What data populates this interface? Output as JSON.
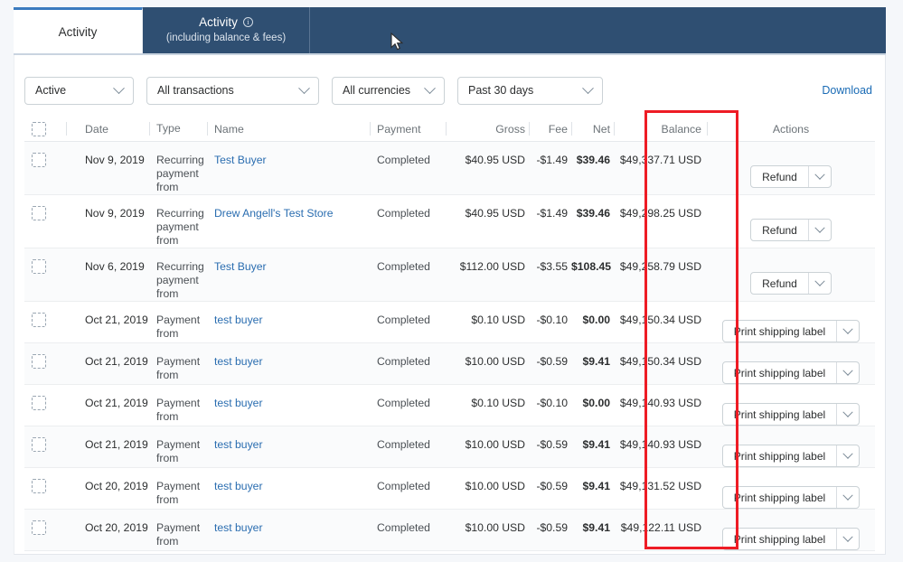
{
  "tabs": [
    {
      "label": "Activity",
      "sublabel": "",
      "info_icon": "",
      "active": true
    },
    {
      "label": "Activity",
      "sublabel": "(including balance & fees)",
      "info_icon": "i",
      "active": false
    },
    {
      "label": "",
      "sublabel": "",
      "info_icon": "",
      "active": false
    }
  ],
  "filters": {
    "status": "Active",
    "transactions": "All transactions",
    "currencies": "All currencies",
    "date_range": "Past 30 days",
    "download_label": "Download"
  },
  "table": {
    "headers": {
      "checkbox": "",
      "date": "Date",
      "type": "Type",
      "name": "Name",
      "payment": "Payment",
      "gross": "Gross",
      "fee": "Fee",
      "net": "Net",
      "balance": "Balance",
      "actions": "Actions"
    },
    "rows": [
      {
        "date": "Nov 9, 2019",
        "type": "Recurring payment from",
        "name": "Test Buyer",
        "payment": "Completed",
        "gross": "$40.95 USD",
        "fee": "-$1.49",
        "net": "$39.46",
        "balance": "$49,337.71 USD",
        "action": "Refund"
      },
      {
        "date": "Nov 9, 2019",
        "type": "Recurring payment from",
        "name": "Drew Angell's Test Store",
        "payment": "Completed",
        "gross": "$40.95 USD",
        "fee": "-$1.49",
        "net": "$39.46",
        "balance": "$49,298.25 USD",
        "action": "Refund"
      },
      {
        "date": "Nov 6, 2019",
        "type": "Recurring payment from",
        "name": "Test Buyer",
        "payment": "Completed",
        "gross": "$112.00 USD",
        "fee": "-$3.55",
        "net": "$108.45",
        "balance": "$49,258.79 USD",
        "action": "Refund"
      },
      {
        "date": "Oct 21, 2019",
        "type": "Payment from",
        "name": "test buyer",
        "payment": "Completed",
        "gross": "$0.10 USD",
        "fee": "-$0.10",
        "net": "$0.00",
        "balance": "$49,150.34 USD",
        "action": "Print shipping label"
      },
      {
        "date": "Oct 21, 2019",
        "type": "Payment from",
        "name": "test buyer",
        "payment": "Completed",
        "gross": "$10.00 USD",
        "fee": "-$0.59",
        "net": "$9.41",
        "balance": "$49,150.34 USD",
        "action": "Print shipping label"
      },
      {
        "date": "Oct 21, 2019",
        "type": "Payment from",
        "name": "test buyer",
        "payment": "Completed",
        "gross": "$0.10 USD",
        "fee": "-$0.10",
        "net": "$0.00",
        "balance": "$49,140.93 USD",
        "action": "Print shipping label"
      },
      {
        "date": "Oct 21, 2019",
        "type": "Payment from",
        "name": "test buyer",
        "payment": "Completed",
        "gross": "$10.00 USD",
        "fee": "-$0.59",
        "net": "$9.41",
        "balance": "$49,140.93 USD",
        "action": "Print shipping label"
      },
      {
        "date": "Oct 20, 2019",
        "type": "Payment from",
        "name": "test buyer",
        "payment": "Completed",
        "gross": "$10.00 USD",
        "fee": "-$0.59",
        "net": "$9.41",
        "balance": "$49,131.52 USD",
        "action": "Print shipping label"
      },
      {
        "date": "Oct 20, 2019",
        "type": "Payment from",
        "name": "test buyer",
        "payment": "Completed",
        "gross": "$10.00 USD",
        "fee": "-$0.59",
        "net": "$9.41",
        "balance": "$49,122.11 USD",
        "action": "Print shipping label"
      }
    ]
  },
  "annotation": {
    "shape": "rectangle",
    "color": "#ee1c25",
    "target_column": "Balance"
  },
  "colors": {
    "tab_bar": "#2f4f72",
    "link": "#2a6db0",
    "download_link": "#1a6bb5",
    "annotation_red": "#ee1c25",
    "row_shade": "#fafbfc"
  }
}
